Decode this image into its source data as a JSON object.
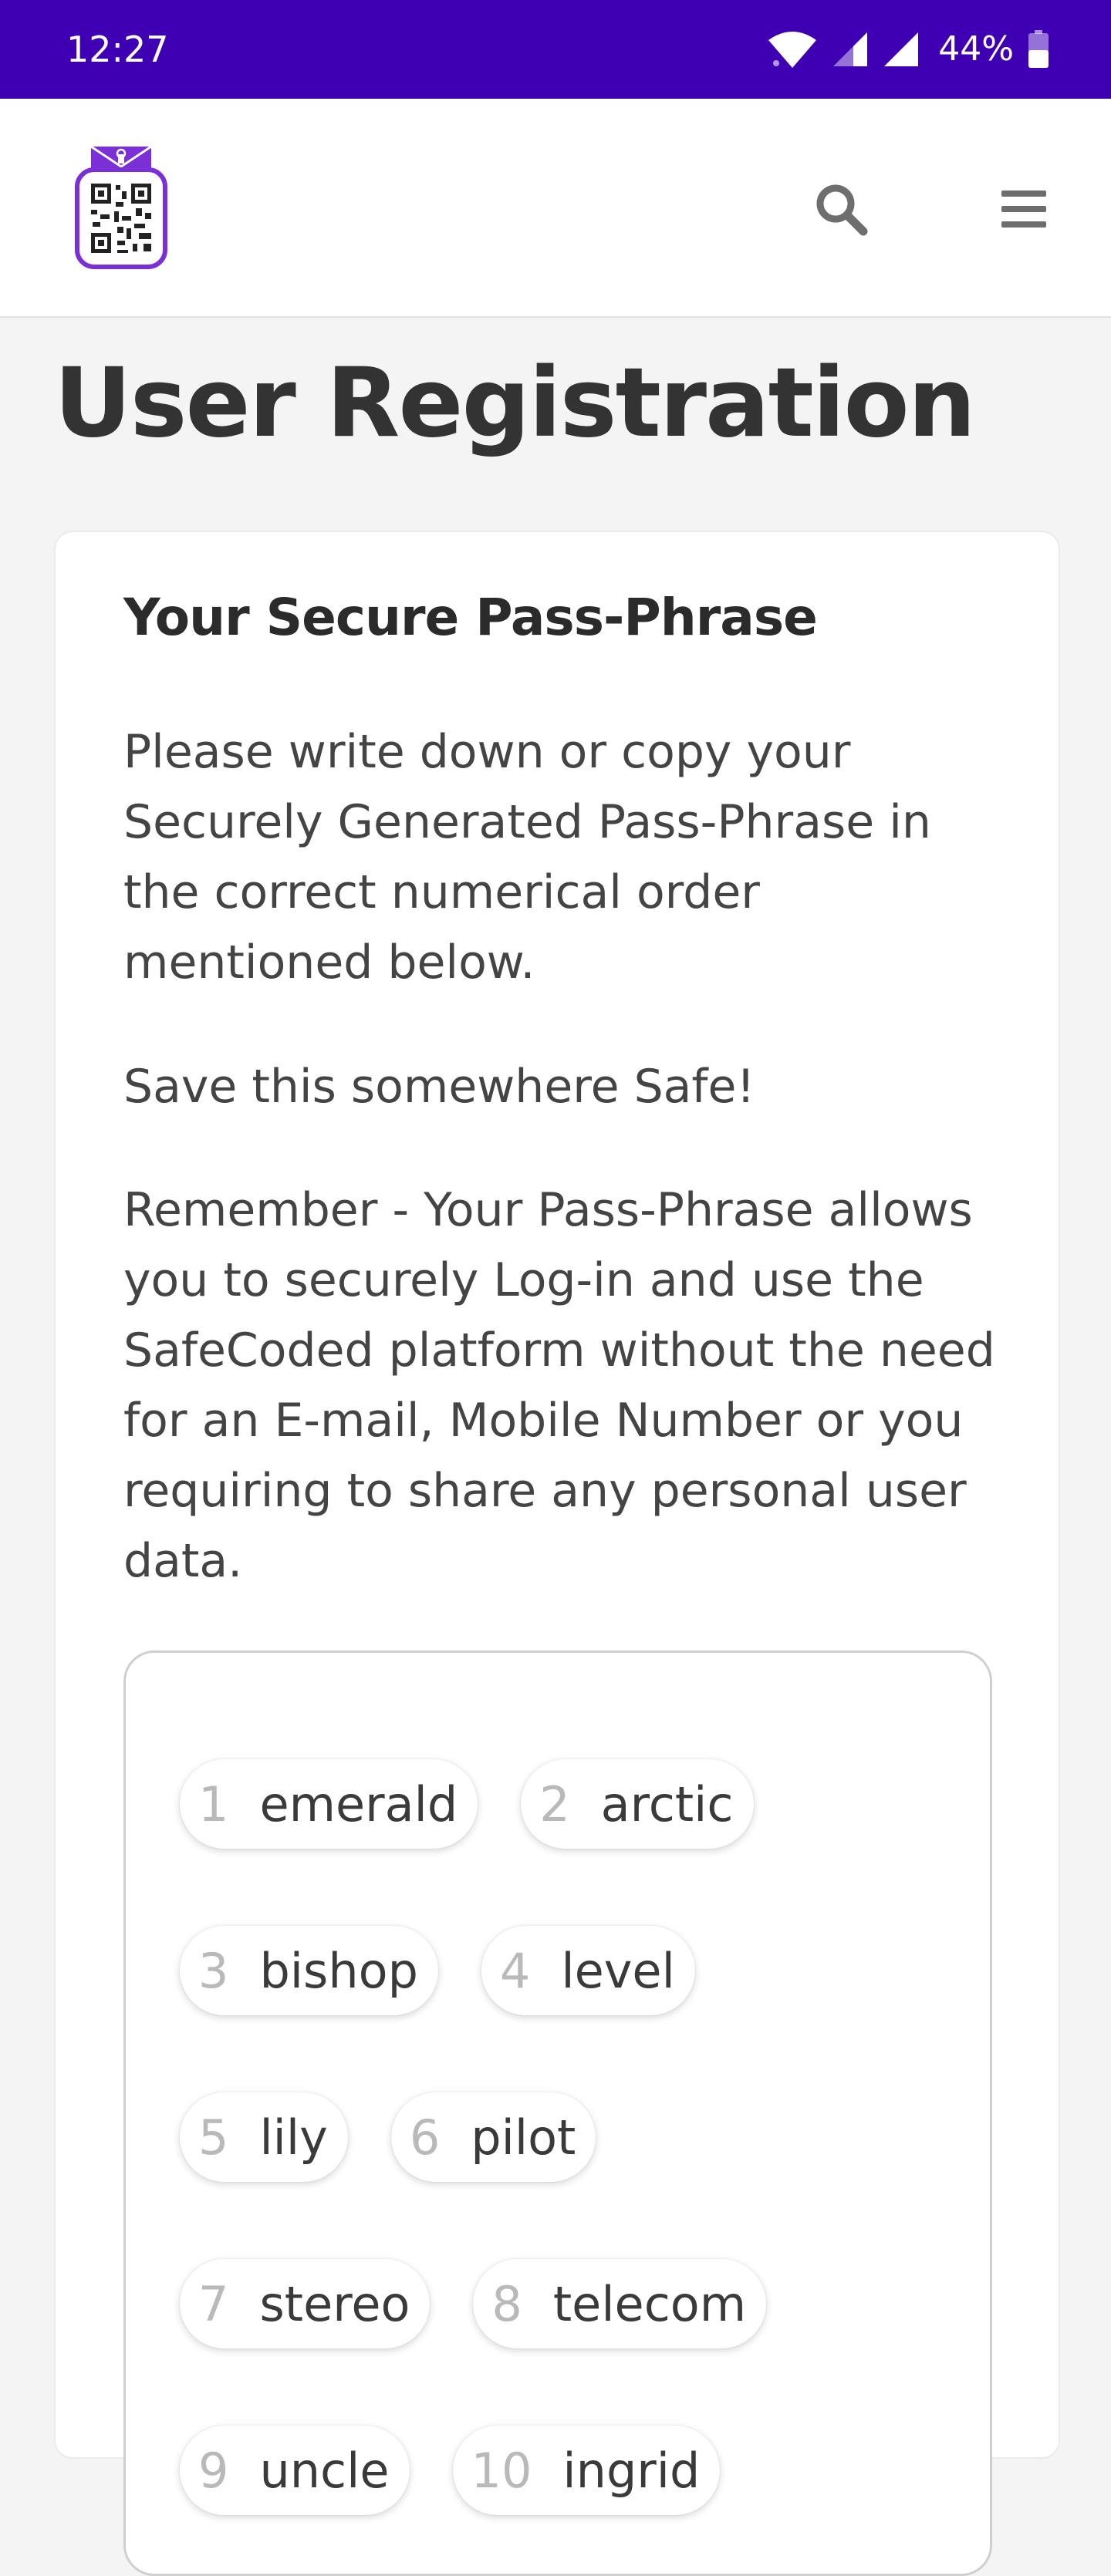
{
  "status_bar": {
    "time": "12:27",
    "battery": "44%",
    "icons": [
      "wifi-icon",
      "signal-icon",
      "signal-icon",
      "battery-icon"
    ]
  },
  "header": {
    "logo": "safecoded-qr-envelope-logo",
    "search_icon": "search-icon",
    "menu_icon": "menu-icon"
  },
  "page": {
    "title": "User Registration"
  },
  "card": {
    "heading": "Your Secure Pass-Phrase",
    "paragraph_1": "Please write down or copy your Securely Generated Pass-Phrase in the correct numerical order mentioned below.",
    "paragraph_2": "Save this somewhere Safe!",
    "paragraph_3": "Remember - Your Pass-Phrase allows you to securely Log-in and use the SafeCoded platform without the need for an E-mail, Mobile Number or you requiring to share any personal user data."
  },
  "pass_phrase": [
    {
      "num": "1",
      "word": "emerald"
    },
    {
      "num": "2",
      "word": "arctic"
    },
    {
      "num": "3",
      "word": "bishop"
    },
    {
      "num": "4",
      "word": "level"
    },
    {
      "num": "5",
      "word": "lily"
    },
    {
      "num": "6",
      "word": "pilot"
    },
    {
      "num": "7",
      "word": "stereo"
    },
    {
      "num": "8",
      "word": "telecom"
    },
    {
      "num": "9",
      "word": "uncle"
    },
    {
      "num": "10",
      "word": "ingrid"
    }
  ],
  "colors": {
    "status_bar": "#3f00b4",
    "brand_purple": "#7b2fd6",
    "background": "#f4f4f4",
    "text": "#333333",
    "chip_number": "#b9b9b9"
  }
}
